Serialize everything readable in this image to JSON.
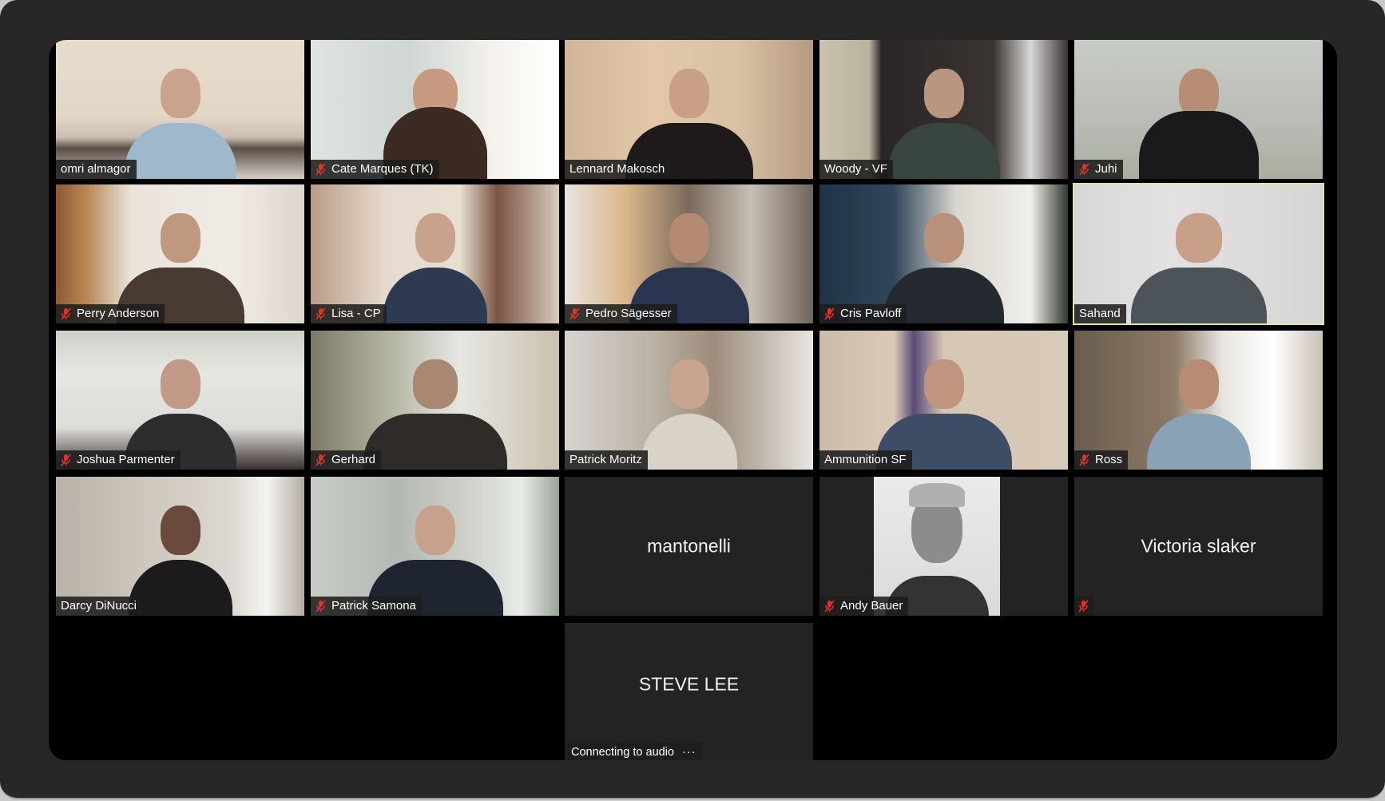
{
  "app": {
    "view": "Gallery View",
    "active_speaker": "Sahand"
  },
  "colors": {
    "frame": "#272727",
    "panel": "#000000",
    "tile_placeholder": "#232323",
    "active_speaker_border": "#d9e89a",
    "muted_icon": "#e0322b",
    "label_text": "#ffffff"
  },
  "participants": [
    {
      "name": "omri almagor",
      "muted": false,
      "video": true
    },
    {
      "name": "Cate Marques (TK)",
      "muted": true,
      "video": true
    },
    {
      "name": "Lennard Makosch",
      "muted": false,
      "video": true
    },
    {
      "name": "Woody - VF",
      "muted": false,
      "video": true
    },
    {
      "name": "Juhi",
      "muted": true,
      "video": true
    },
    {
      "name": "Perry Anderson",
      "muted": true,
      "video": true
    },
    {
      "name": "Lisa - CP",
      "muted": true,
      "video": true
    },
    {
      "name": "Pedro Sägesser",
      "muted": true,
      "video": true
    },
    {
      "name": "Cris Pavloff",
      "muted": true,
      "video": true
    },
    {
      "name": "Sahand",
      "muted": false,
      "video": true,
      "active": true
    },
    {
      "name": "Joshua Parmenter",
      "muted": true,
      "video": true
    },
    {
      "name": "Gerhard",
      "muted": true,
      "video": true
    },
    {
      "name": "Patrick Moritz",
      "muted": false,
      "video": true
    },
    {
      "name": "Ammunition SF",
      "muted": false,
      "video": true
    },
    {
      "name": "Ross",
      "muted": true,
      "video": true
    },
    {
      "name": "Darcy DiNucci",
      "muted": false,
      "video": true
    },
    {
      "name": "Patrick Samona",
      "muted": true,
      "video": true
    },
    {
      "name": "mantonelli",
      "muted": false,
      "video": false
    },
    {
      "name": "Andy Bauer",
      "muted": true,
      "video": false,
      "profile_photo": true
    },
    {
      "name": "Victoria slaker",
      "muted": true,
      "video": false
    },
    {
      "name": "STEVE LEE",
      "muted": false,
      "video": false,
      "status": "Connecting to audio",
      "status_icon": "ellipsis-icon"
    }
  ],
  "icons": {
    "muted": "mic-muted-icon"
  }
}
